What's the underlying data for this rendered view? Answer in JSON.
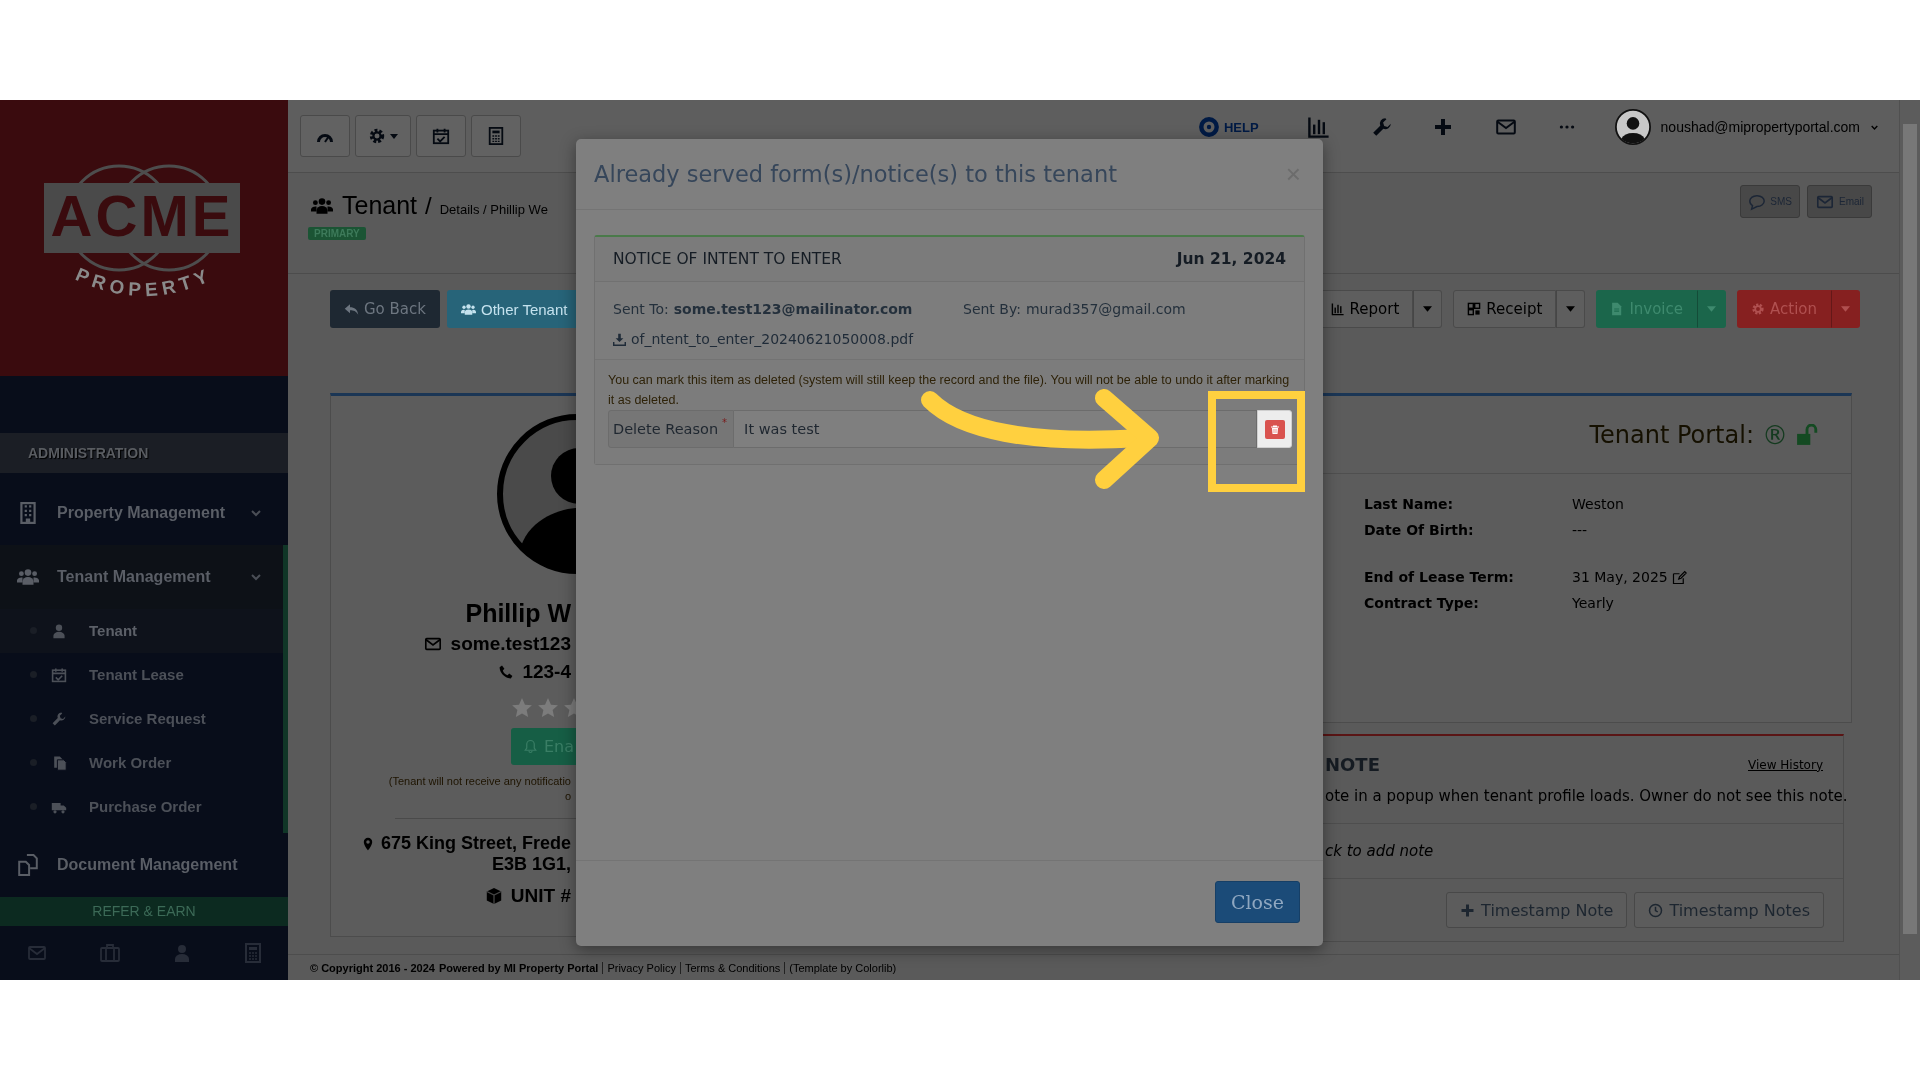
{
  "sidebar": {
    "logo": {
      "wordmark": "ACME",
      "tagline": "PROPERTY"
    },
    "section_title": "ADMINISTRATION",
    "items": [
      {
        "label": "Property Management",
        "expandable": true,
        "expanded": false
      },
      {
        "label": "Tenant Management",
        "expandable": true,
        "expanded": true,
        "children": [
          {
            "label": "Tenant",
            "selected": true
          },
          {
            "label": "Tenant Lease",
            "selected": false
          },
          {
            "label": "Service Request",
            "selected": false
          },
          {
            "label": "Work Order",
            "selected": false
          },
          {
            "label": "Purchase Order",
            "selected": false
          }
        ]
      },
      {
        "label": "Document Management",
        "expandable": false,
        "expanded": false
      }
    ],
    "refer_button": "REFER & EARN"
  },
  "topbar": {
    "help": "HELP",
    "user_email": "noushad@mipropertyportal.com"
  },
  "page_header": {
    "title": "Tenant",
    "separator": "/",
    "breadcrumb": "Details / Phillip We",
    "badge": "PRIMARY",
    "share_buttons": [
      {
        "label": "SMS",
        "kind": "sms"
      },
      {
        "label": "Email",
        "kind": "email"
      }
    ]
  },
  "actions": {
    "left": [
      {
        "label": "Go Back",
        "kind": "dark"
      },
      {
        "label": "Other Tenant",
        "kind": "info"
      }
    ],
    "right": [
      {
        "label": "Report",
        "kind": "default"
      },
      {
        "label": "Receipt",
        "kind": "default"
      },
      {
        "label": "Invoice",
        "kind": "success"
      },
      {
        "label": "Action",
        "kind": "danger"
      }
    ]
  },
  "profile": {
    "name": "Phillip W",
    "email": "some.test123",
    "phone": "123-4",
    "rating": [
      {
        "filled": false
      },
      {
        "filled": false
      },
      {
        "filled": false
      }
    ],
    "notify_button": "Ena",
    "notify_note": [
      "(Tenant will not receive any notificatio",
      "o"
    ],
    "address": [
      "675 King Street, Frede",
      "E3B 1G1,"
    ],
    "unit": "UNIT #"
  },
  "tenant_portal": {
    "label": "Tenant Portal:",
    "symbol": "®",
    "unlocked": true
  },
  "details": [
    {
      "fields": [
        {
          "label": "Last Name:",
          "value": "Weston",
          "editable": false
        },
        {
          "label": "Date Of Birth:",
          "value": "---",
          "editable": false
        }
      ]
    },
    {
      "fields": [
        {
          "label": "End of Lease Term:",
          "value": "31 May, 2025",
          "editable": true
        },
        {
          "label": "Contract Type:",
          "value": "Yearly",
          "editable": false
        }
      ]
    }
  ],
  "note_card": {
    "title": "NOTE",
    "history_link": "View History",
    "description": "ote in a popup when tenant profile loads. Owner do not see this note.",
    "add_note_prompt": "ck to add note",
    "buttons": [
      {
        "label": "Timestamp Note",
        "kind": "add"
      },
      {
        "label": "Timestamp Notes",
        "kind": "history"
      }
    ]
  },
  "footer": {
    "copyright": "© Copyright 2016 - 2024",
    "powered": "Powered by MI Property Portal",
    "links": [
      "Privacy Policy",
      "Terms & Conditions"
    ],
    "credit": "(Template by Colorlib)"
  },
  "modal": {
    "title": "Already served form(s)/notice(s) to this tenant",
    "close_icon": "×",
    "notices": [
      {
        "title": "NOTICE OF INTENT TO ENTER",
        "date": "Jun 21, 2024",
        "sent_to_label": "Sent To:",
        "sent_to": "some.test123@mailinator.com",
        "sent_by_label": "Sent By:",
        "sent_by": "murad357@gmail.com",
        "file": "of_ntent_to_enter_20240621050008.pdf",
        "warning": "You can mark this item as deleted (system will still keep the record and the file). You will not be able to undo it after marking it as deleted.",
        "delete_reason": {
          "label": "Delete Reason",
          "required_mark": "*",
          "value": "It was test"
        }
      }
    ],
    "close_button": "Close"
  }
}
